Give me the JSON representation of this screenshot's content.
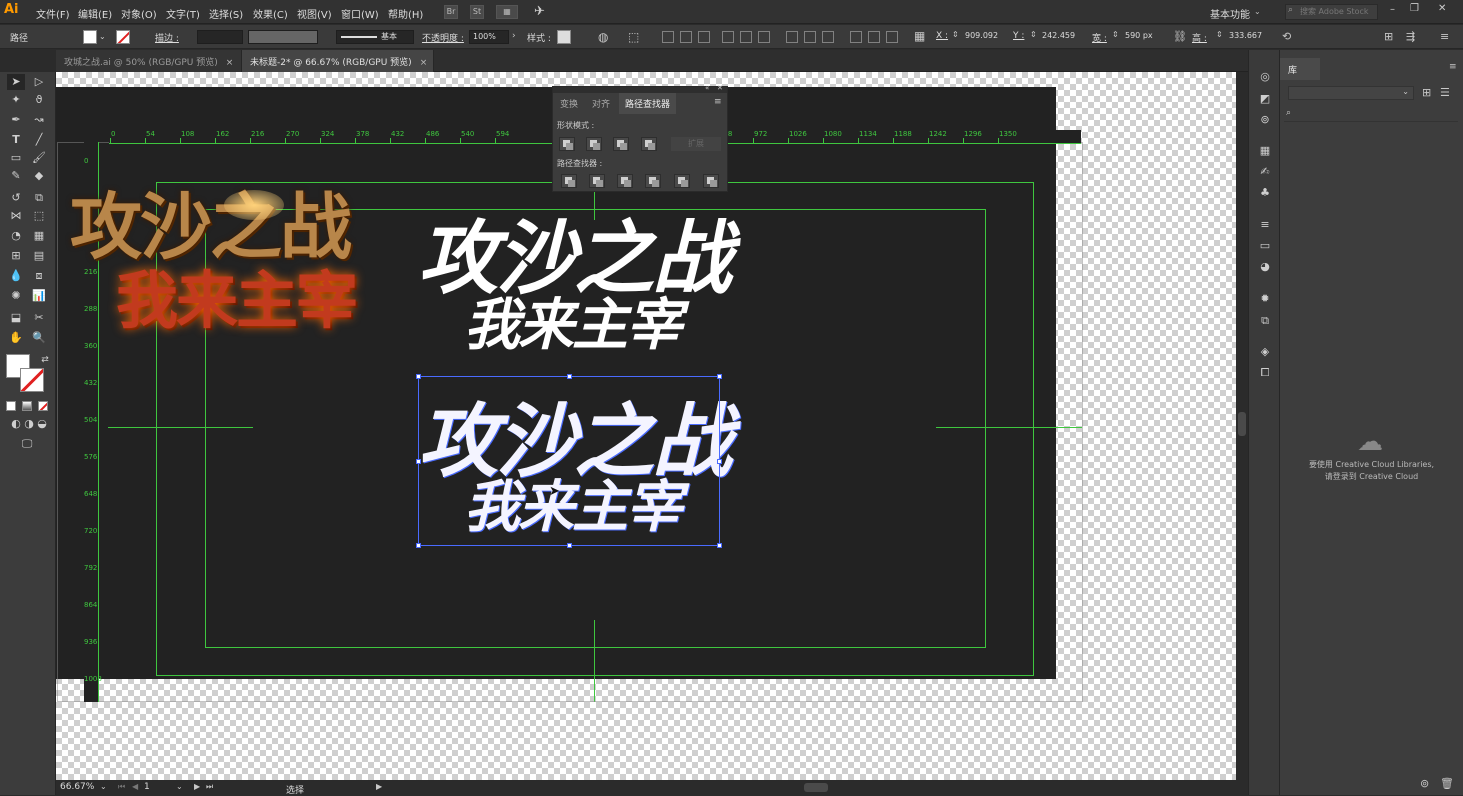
{
  "app": {
    "logo": "Ai"
  },
  "menubar": {
    "items": [
      "文件(F)",
      "编辑(E)",
      "对象(O)",
      "文字(T)",
      "选择(S)",
      "效果(C)",
      "视图(V)",
      "窗口(W)",
      "帮助(H)"
    ],
    "bridge": "Br",
    "stock": "St",
    "workspace": "基本功能",
    "search_placeholder": "搜索 Adobe Stock"
  },
  "control": {
    "selection_type": "路径",
    "stroke_label": "描边 :",
    "stroke_style": "基本",
    "opacity_label": "不透明度 :",
    "opacity_value": "100%",
    "style_label": "样式 :",
    "x_label": "X :",
    "x_value": "909.092",
    "y_label": "Y :",
    "y_value": "242.459",
    "w_label": "宽 :",
    "w_value": "590 px",
    "h_label": "高 :",
    "h_value": "333.667"
  },
  "tabs": [
    {
      "label": "攻城之战.ai @ 50% (RGB/GPU 预览)",
      "close": "×"
    },
    {
      "label": "未标题-2* @ 66.67% (RGB/GPU 预览)",
      "close": "×"
    }
  ],
  "ruler": {
    "h_ticks": [
      "0",
      "54",
      "108",
      "162",
      "216",
      "270",
      "324",
      "378",
      "432",
      "486",
      "540",
      "594",
      "918",
      "972",
      "1026",
      "1080",
      "1134",
      "1188",
      "1242",
      "1296",
      "1350"
    ],
    "v_ticks": [
      "0",
      "144",
      "216",
      "288",
      "360",
      "432",
      "504",
      "576",
      "648",
      "720",
      "792",
      "864",
      "936",
      "1008"
    ]
  },
  "artwork": {
    "logo_line1": "攻沙之战",
    "logo_line2": "我来主宰"
  },
  "pathfinder": {
    "tabs": [
      "变换",
      "对齐",
      "路径查找器"
    ],
    "shape_modes_label": "形状模式 :",
    "expand_label": "扩展",
    "pathfinders_label": "路径查找器 :"
  },
  "status": {
    "zoom": "66.67%",
    "artboard": "1",
    "tool": "选择"
  },
  "library": {
    "title": "库",
    "message_line1": "要使用 Creative Cloud Libraries,",
    "message_line2": "请登录到 Creative Cloud"
  },
  "colors": {
    "guide": "#3fc63f",
    "selection": "#4a6bff",
    "accent": "#ff9a00"
  }
}
